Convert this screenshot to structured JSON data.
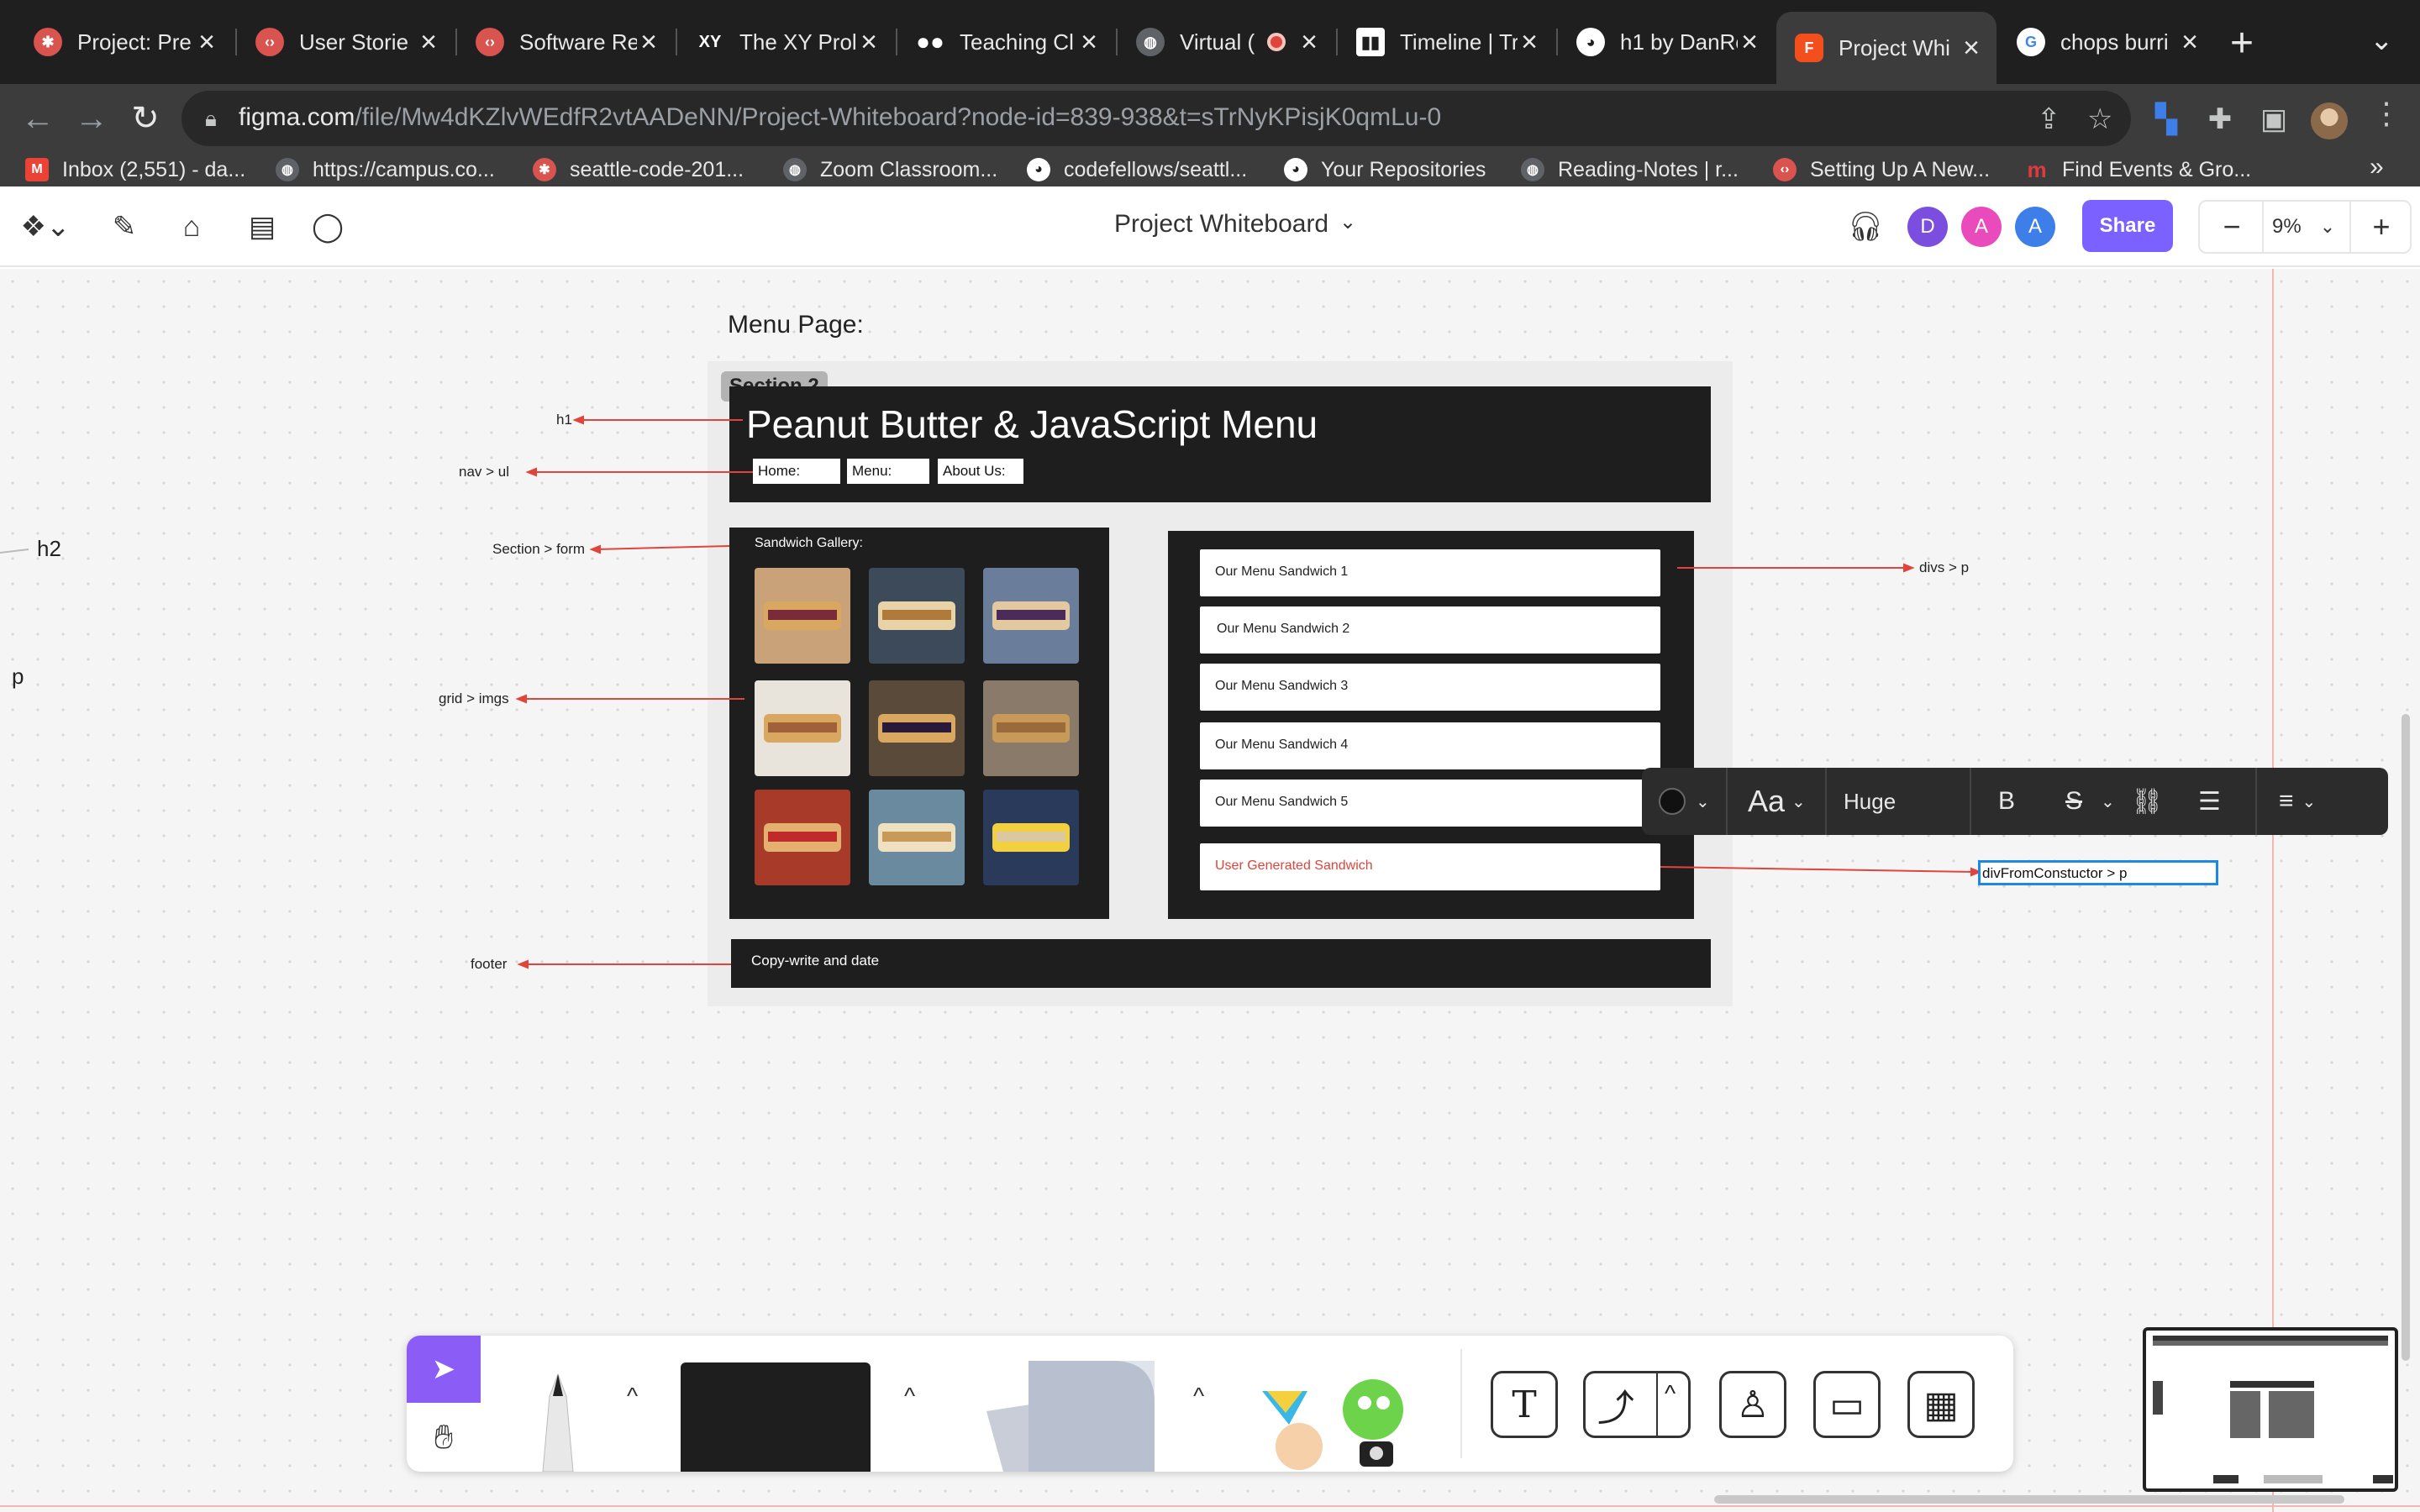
{
  "browser": {
    "tabs": [
      {
        "label": "Project: Pre",
        "icon": "codefellows-icon",
        "color": "#d9534f"
      },
      {
        "label": "User Storie",
        "icon": "codefellows-icon",
        "color": "#d9534f"
      },
      {
        "label": "Software Re",
        "icon": "codefellows-icon",
        "color": "#d9534f"
      },
      {
        "label": "The XY Prol",
        "icon": "xy-icon",
        "color": "#1f1f1f"
      },
      {
        "label": "Teaching Cl",
        "icon": "medium-icon",
        "color": "#1f1f1f"
      },
      {
        "label": "Virtual (",
        "icon": "globe-icon",
        "color": "#5f6368"
      },
      {
        "label": "Timeline | Tr",
        "icon": "trello-icon",
        "color": "#1f1f1f"
      },
      {
        "label": "h1 by DanRe",
        "icon": "github-icon",
        "color": "#1f1f1f"
      },
      {
        "label": "Project Whi",
        "icon": "figma-icon",
        "color": "#f24e1e"
      },
      {
        "label": "chops burri",
        "icon": "google-icon",
        "color": "#4285f4"
      }
    ],
    "url_domain": "figma.com",
    "url_path": "/file/Mw4dKZlvWEdfR2vtAADeNN/Project-Whiteboard?node-id=839-938&t=sTrNyKPisjK0qmLu-0",
    "bookmarks": [
      {
        "label": "Inbox (2,551) - da...",
        "icon": "gmail-icon",
        "color": "#ea4335"
      },
      {
        "label": "https://campus.co...",
        "icon": "globe-icon",
        "color": "#5f6368"
      },
      {
        "label": "seattle-code-201...",
        "icon": "codefellows-icon",
        "color": "#d9534f"
      },
      {
        "label": "Zoom Classroom...",
        "icon": "globe-icon",
        "color": "#5f6368"
      },
      {
        "label": "codefellows/seattl...",
        "icon": "github-icon",
        "color": "#1f1f1f"
      },
      {
        "label": "Your Repositories",
        "icon": "github-icon",
        "color": "#1f1f1f"
      },
      {
        "label": "Reading-Notes | r...",
        "icon": "globe-icon",
        "color": "#5f6368"
      },
      {
        "label": "Setting Up A New...",
        "icon": "codefellows-icon",
        "color": "#d9534f"
      },
      {
        "label": "Find Events & Gro...",
        "icon": "meetup-icon",
        "color": "#e0393e"
      }
    ],
    "more": "»"
  },
  "figma": {
    "doc_title": "Project Whiteboard",
    "share_label": "Share",
    "zoom": "9%",
    "avatars": [
      {
        "letter": "D",
        "color": "#7b4ee0"
      },
      {
        "letter": "A",
        "color": "#e94bbd"
      },
      {
        "letter": "A",
        "color": "#3d7ee8"
      }
    ]
  },
  "canvas": {
    "page_label": "Menu Page:",
    "section_badge": "Section 2",
    "h1_text": "Peanut Butter & JavaScript Menu",
    "nav_items": [
      "Home:",
      "Menu:",
      "About Us:"
    ],
    "gallery_title": "Sandwich Gallery:",
    "menu_items": [
      "Our Menu Sandwich 1",
      "Our Menu Sandwich 2",
      "Our Menu Sandwich 3",
      "Our Menu Sandwich 4",
      "Our Menu Sandwich 5"
    ],
    "user_item": "User Generated Sandwich",
    "user_item_color": "#e0443a",
    "footer_text": "Copy-write and date",
    "notes": {
      "h1": "h1",
      "nav": "nav > ul",
      "form": "Section > form",
      "grid": "grid > imgs",
      "footer": "footer",
      "divs": "divs > p",
      "constructor": "divFromConstuctor > p",
      "h2": "h2",
      "p": "p"
    }
  },
  "text_toolbar": {
    "font_icon": "Aa",
    "size": "Huge"
  },
  "colors": {
    "accent": "#7b61ff",
    "annotation": "#e0443a",
    "selection": "#1e88e5"
  }
}
